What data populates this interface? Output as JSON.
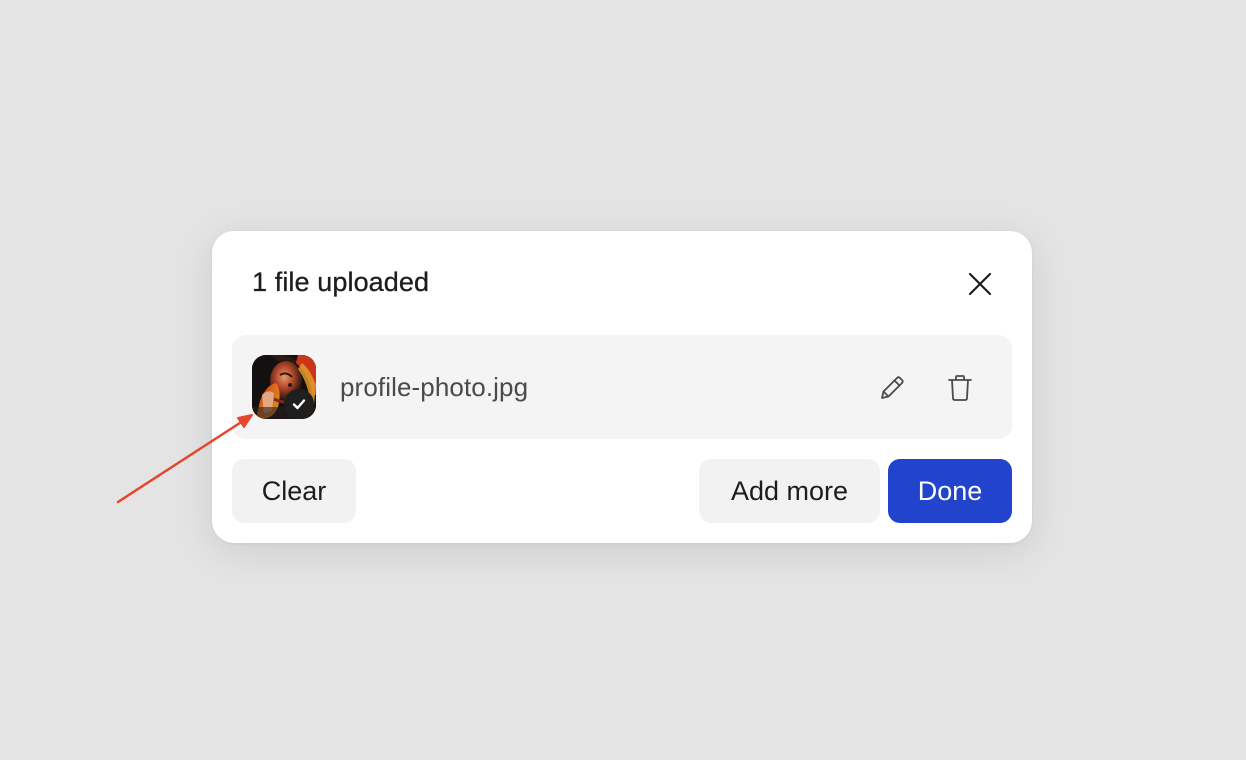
{
  "dialog": {
    "title": "1 file uploaded",
    "close_icon": "close-icon"
  },
  "file": {
    "name": "profile-photo.jpg",
    "thumbnail_icon": "image-thumbnail",
    "status_icon": "checkmark-icon",
    "edit_icon": "pencil-icon",
    "delete_icon": "trash-icon"
  },
  "buttons": {
    "clear_label": "Clear",
    "add_more_label": "Add more",
    "done_label": "Done"
  },
  "colors": {
    "background": "#e4e4e4",
    "dialog": "#ffffff",
    "row": "#f4f4f4",
    "primary": "#2244cc",
    "annotation_arrow": "#e8452f"
  }
}
